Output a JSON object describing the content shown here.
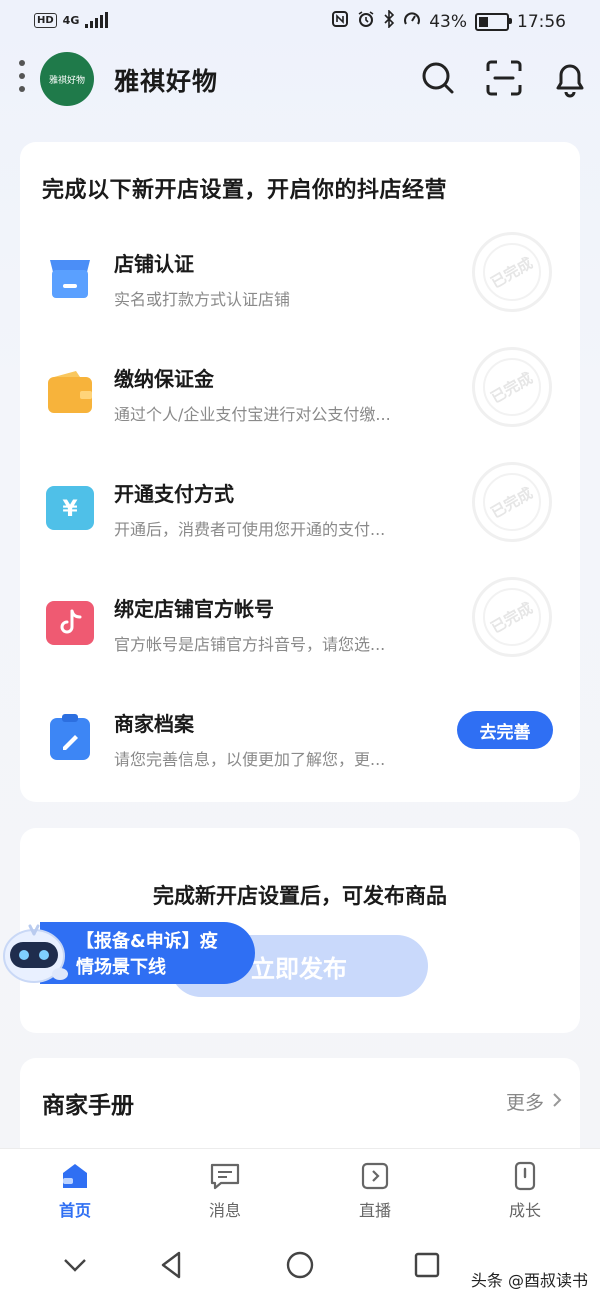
{
  "status_bar": {
    "hd": "HD",
    "network": "4G",
    "battery_percent": "43%",
    "battery_level": 0.43,
    "time": "17:56"
  },
  "header": {
    "logo_text": "雅祺好物",
    "shop_name": "雅祺好物",
    "icons": [
      "menu-dots-icon",
      "search-icon",
      "scan-icon",
      "bell-icon"
    ]
  },
  "setup_card": {
    "title": "完成以下新开店设置，开启你的抖店经营",
    "completed_stamp": "已完成",
    "tasks": [
      {
        "icon": "store-icon",
        "name": "店铺认证",
        "desc": "实名或打款方式认证店铺",
        "done": true
      },
      {
        "icon": "wallet-icon",
        "name": "缴纳保证金",
        "desc": "通过个人/企业支付宝进行对公支付缴...",
        "done": true
      },
      {
        "icon": "yuan-icon",
        "name": "开通支付方式",
        "desc": "开通后，消费者可使用您开通的支付...",
        "done": true
      },
      {
        "icon": "tiktok-icon",
        "name": "绑定店铺官方帐号",
        "desc": "官方帐号是店铺官方抖音号，请您选...",
        "done": true
      },
      {
        "icon": "clipboard-icon",
        "name": "商家档案",
        "desc": "请您完善信息，以便更加了解您，更...",
        "done": false,
        "action": "去完善"
      }
    ]
  },
  "publish_card": {
    "text": "完成新开店设置后，可发布商品",
    "button": "立即发布"
  },
  "notice": {
    "line1": "【报备&申诉】疫",
    "line2": "情场景下线"
  },
  "manual_card": {
    "title": "商家手册",
    "more": "更多"
  },
  "tabs": [
    {
      "label": "首页",
      "icon": "home-icon",
      "active": true
    },
    {
      "label": "消息",
      "icon": "message-icon",
      "active": false
    },
    {
      "label": "直播",
      "icon": "live-icon",
      "active": false
    },
    {
      "label": "成长",
      "icon": "growth-icon",
      "active": false
    }
  ],
  "watermark": "头条 @酉叔读书",
  "colors": {
    "accent": "#2f6ff3",
    "disabled_button": "#c9d9fb"
  }
}
